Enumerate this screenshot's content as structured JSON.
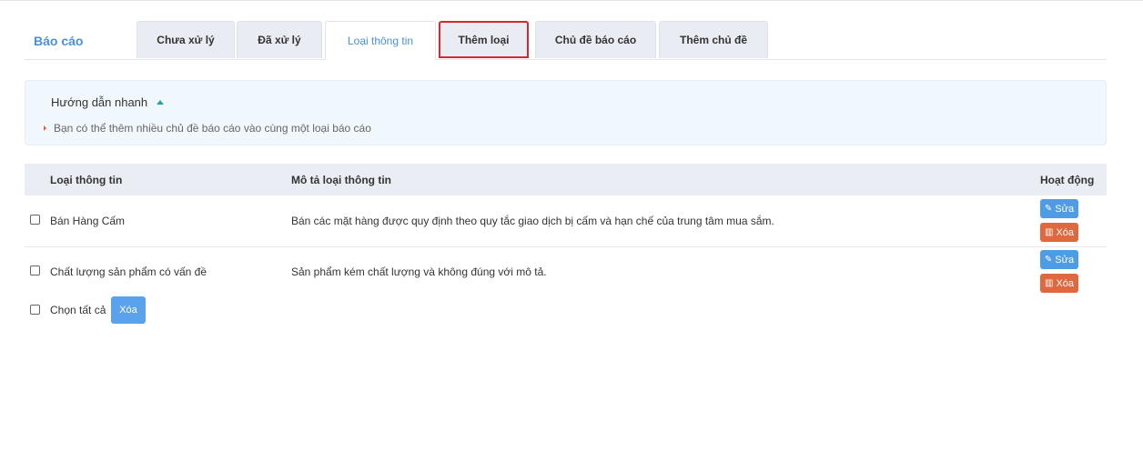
{
  "brand": "Báo cáo",
  "tabs": [
    {
      "label": "Chưa xử lý"
    },
    {
      "label": "Đã xử lý"
    },
    {
      "label": "Loại thông tin"
    },
    {
      "label": "Thêm loại"
    },
    {
      "label": "Chủ đề báo cáo"
    },
    {
      "label": "Thêm chủ đề"
    }
  ],
  "active_tab": "Loại thông tin",
  "guide": {
    "title": "Hướng dẫn nhanh",
    "items": [
      "Bạn có thể thêm nhiều chủ đề báo cáo vào cùng một loại báo cáo"
    ]
  },
  "table": {
    "headers": {
      "type": "Loại thông tin",
      "description": "Mô tả loại thông tin",
      "actions": "Hoạt động"
    },
    "rows": [
      {
        "type": "Bán Hàng Cấm",
        "description": "Bán các mặt hàng được quy định theo quy tắc giao dịch bị cấm và hạn chế của trung tâm mua sắm.",
        "edit": "Sửa",
        "delete": "Xóa"
      },
      {
        "type": "Chất lượng sản phẩm có vấn đề",
        "description": "Sản phẩm kém chất lượng và không đúng với mô tả.",
        "edit": "Sửa",
        "delete": "Xóa"
      }
    ]
  },
  "footer": {
    "select_all": "Chọn tất cả",
    "delete": "Xóa"
  },
  "colors": {
    "accent": "#4a90d9",
    "edit": "#4e9be6",
    "delete": "#e0683e",
    "highlight": "#d9272e"
  }
}
